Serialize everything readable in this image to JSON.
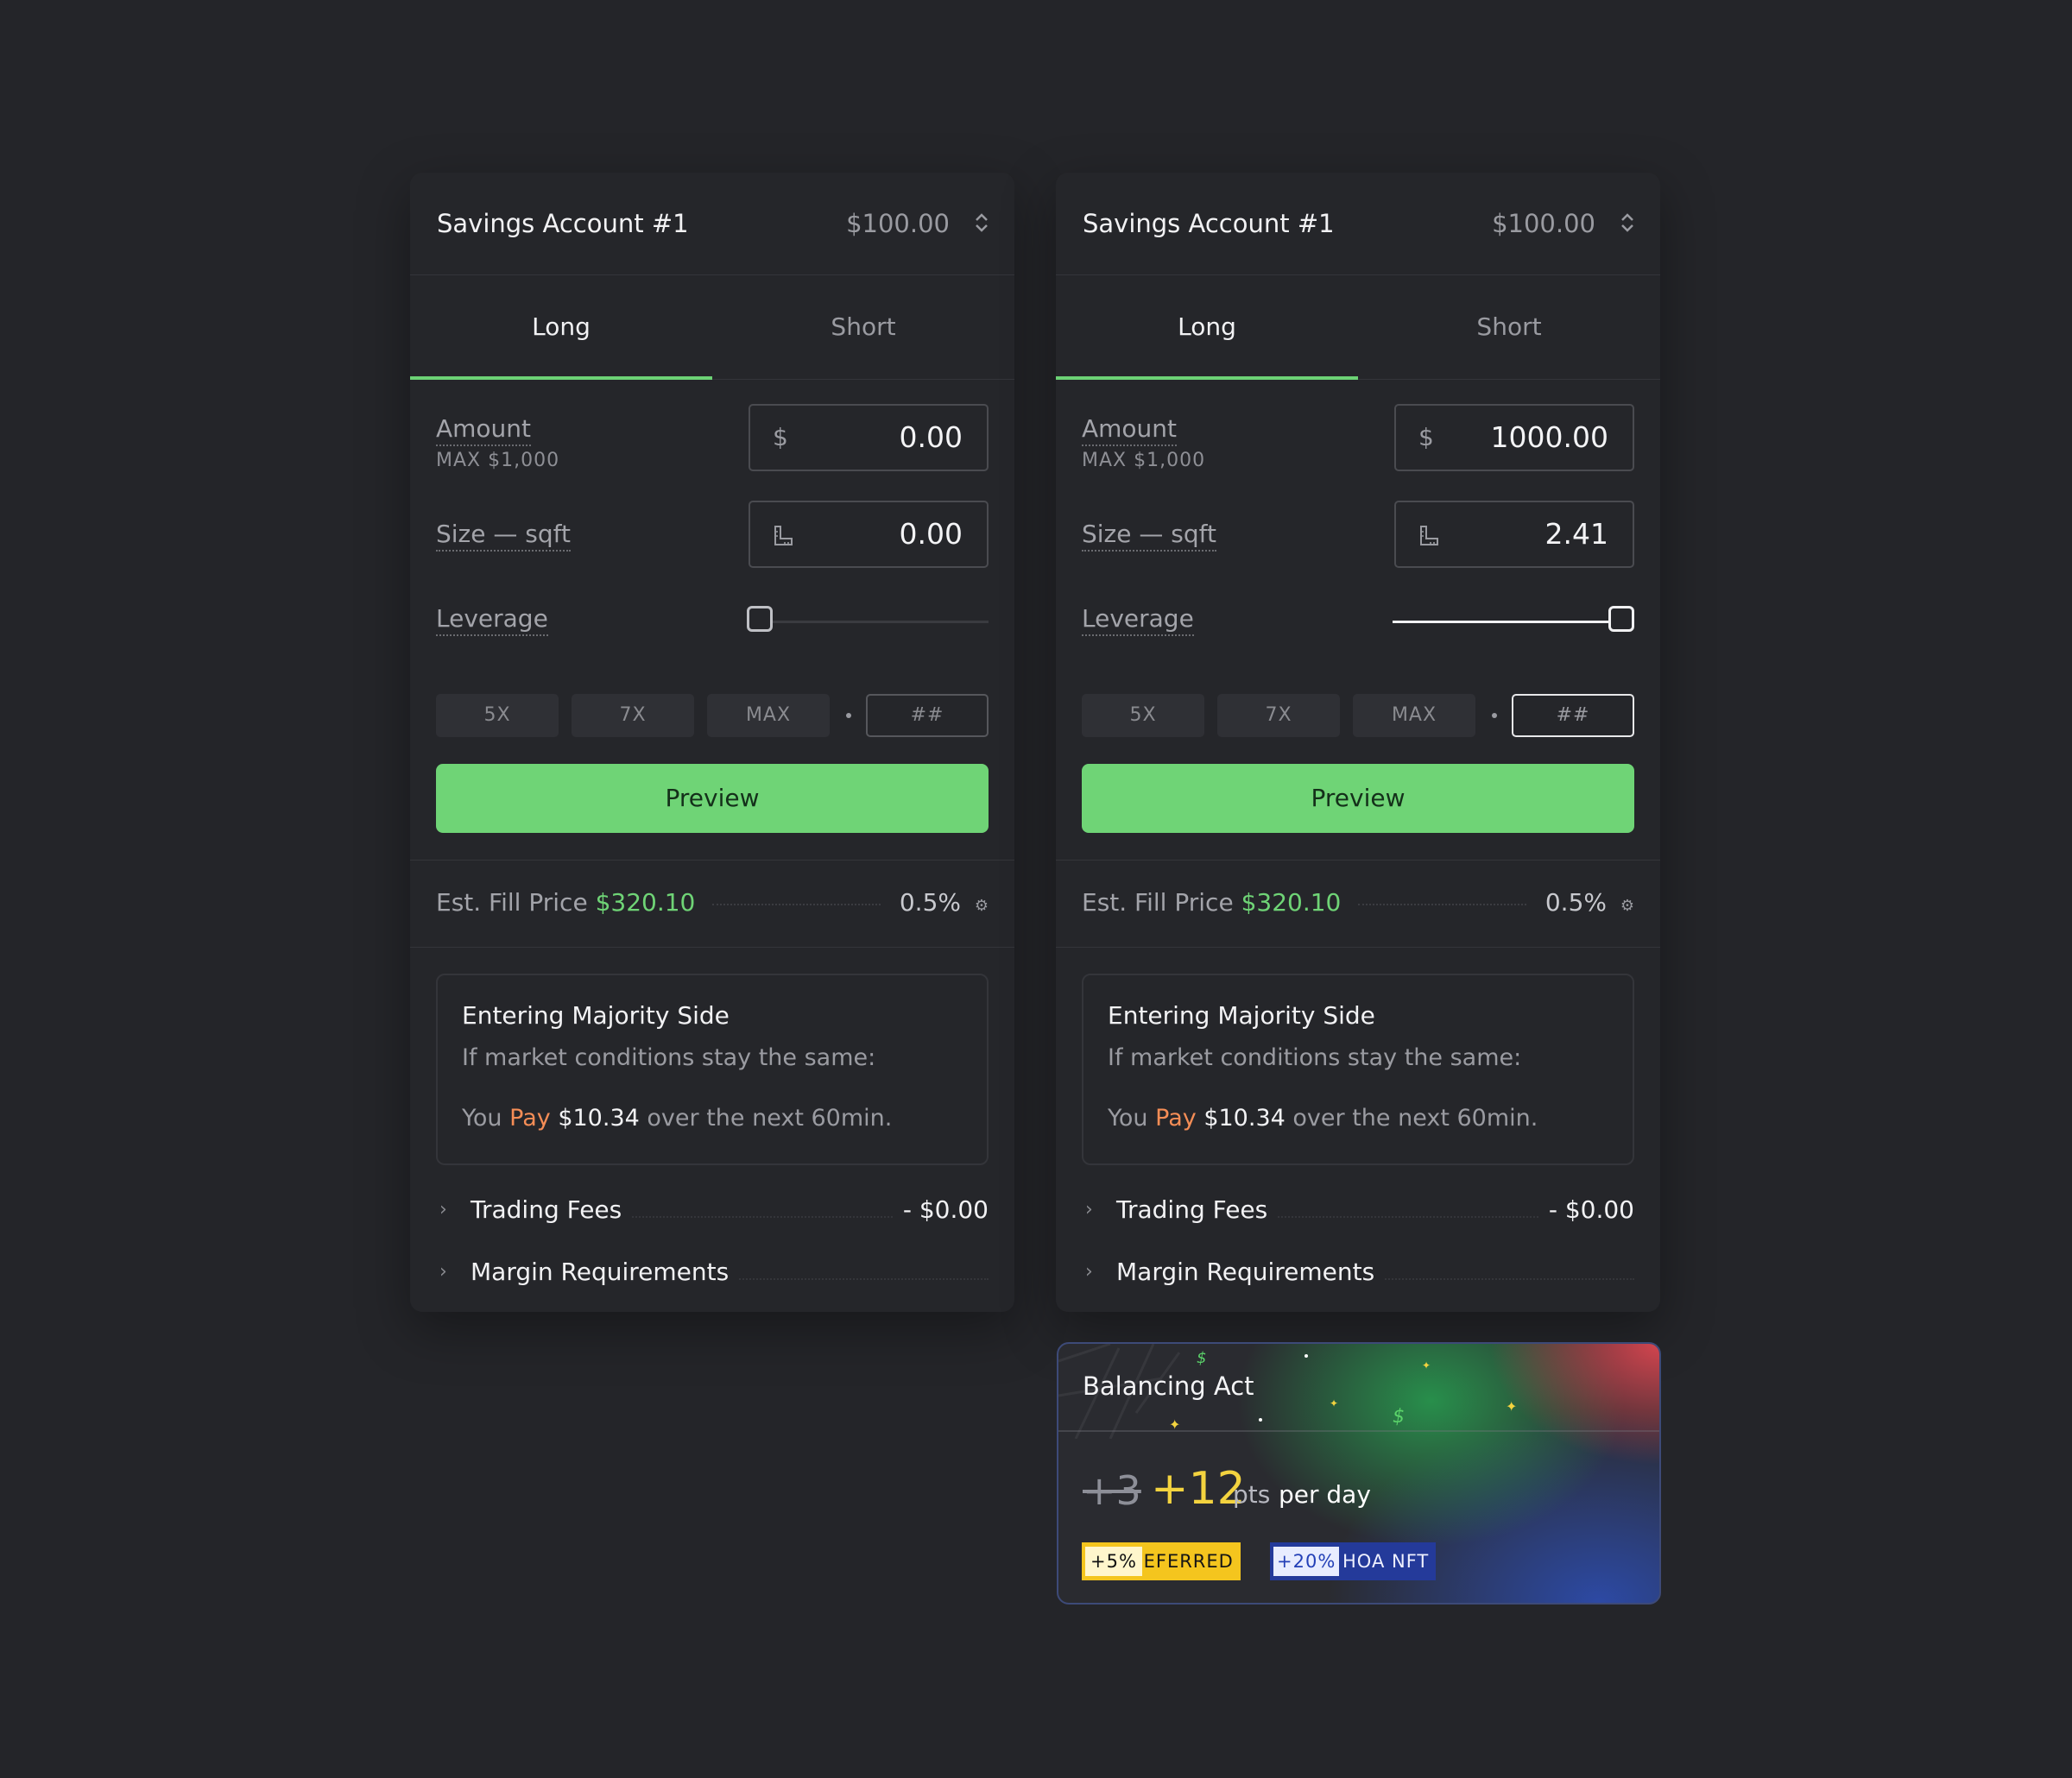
{
  "panels": [
    {
      "account": {
        "name": "Savings Account #1",
        "balance": "$100.00"
      },
      "tabs": {
        "long": "Long",
        "short": "Short",
        "active": "long"
      },
      "amount": {
        "label": "Amount",
        "max_label": "MAX $1,000",
        "prefix": "$",
        "value": "0.00"
      },
      "size": {
        "label": "Size — sqft",
        "value": "0.00"
      },
      "leverage": {
        "label": "Leverage",
        "level": 0
      },
      "chips": {
        "c5": "5X",
        "c7": "7X",
        "max": "MAX",
        "custom": "##"
      },
      "preview_label": "Preview",
      "fill": {
        "label": "Est. Fill Price",
        "price": "$320.10",
        "slippage": "0.5%"
      },
      "notice": {
        "heading": "Entering Majority Side",
        "line1": "If market conditions stay the same:",
        "you": "You",
        "pay": "Pay",
        "amount": "$10.34",
        "rest": "over the next 60min."
      },
      "fees": {
        "label": "Trading Fees",
        "value": "- $0.00"
      },
      "margin": {
        "label": "Margin Requirements"
      }
    },
    {
      "account": {
        "name": "Savings Account #1",
        "balance": "$100.00"
      },
      "tabs": {
        "long": "Long",
        "short": "Short",
        "active": "long"
      },
      "amount": {
        "label": "Amount",
        "max_label": "MAX $1,000",
        "prefix": "$",
        "value": "1000.00"
      },
      "size": {
        "label": "Size — sqft",
        "value": "2.41"
      },
      "leverage": {
        "label": "Leverage",
        "level": 1
      },
      "chips": {
        "c5": "5X",
        "c7": "7X",
        "max": "MAX",
        "custom": "##"
      },
      "preview_label": "Preview",
      "fill": {
        "label": "Est. Fill Price",
        "price": "$320.10",
        "slippage": "0.5%"
      },
      "notice": {
        "heading": "Entering Majority Side",
        "line1": "If market conditions stay the same:",
        "you": "You",
        "pay": "Pay",
        "amount": "$10.34",
        "rest": "over the next 60min."
      },
      "fees": {
        "label": "Trading Fees",
        "value": "- $0.00"
      },
      "margin": {
        "label": "Margin Requirements"
      }
    }
  ],
  "promo": {
    "title": "Balancing Act",
    "old_points": "+3",
    "new_points": "+12",
    "pts_label": "pts",
    "per_day": "per day",
    "badges": [
      {
        "value": "+5%",
        "label": "REFERRED",
        "color": "#f4c51e"
      },
      {
        "value": "+20%",
        "label": "HOA NFT",
        "color": "#243a9a"
      }
    ]
  },
  "colors": {
    "accent": "#6fd476",
    "pay": "#f58d56",
    "highlight": "#f3d33f"
  },
  "icons": {
    "sorter": "sort-updown-icon",
    "amount_prefix": "dollar-icon",
    "size_prefix": "ruler-corner-icon",
    "slippage": "gear-icon",
    "expand": "chevron-right-icon"
  }
}
